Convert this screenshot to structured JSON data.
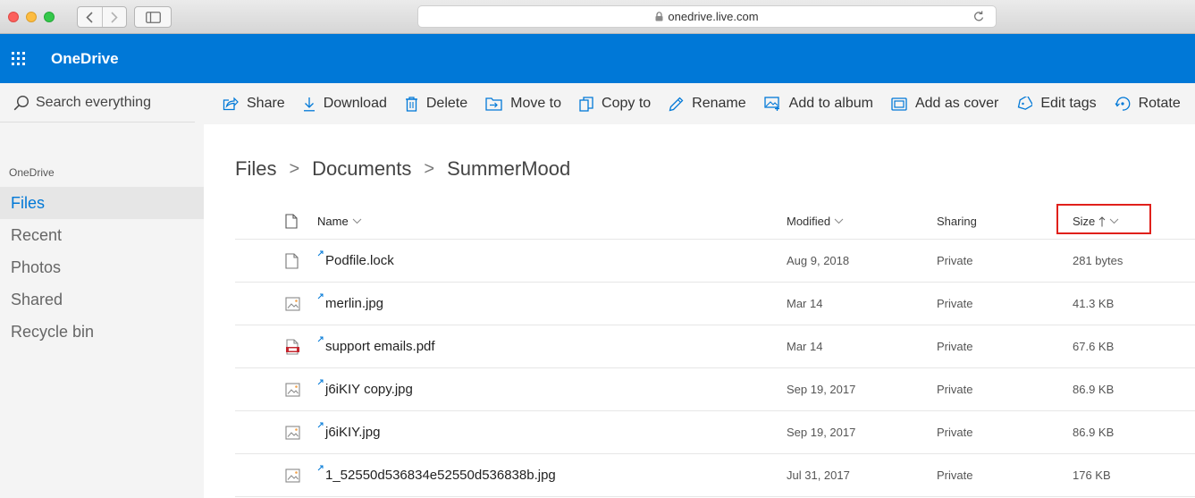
{
  "browser": {
    "url": "onedrive.live.com"
  },
  "app": {
    "brand": "OneDrive"
  },
  "left_nav": {
    "search_placeholder": "Search everything",
    "section_label": "OneDrive",
    "items": [
      {
        "label": "Files",
        "active": true
      },
      {
        "label": "Recent",
        "active": false
      },
      {
        "label": "Photos",
        "active": false
      },
      {
        "label": "Shared",
        "active": false
      },
      {
        "label": "Recycle bin",
        "active": false
      }
    ]
  },
  "command_bar": {
    "share": "Share",
    "download": "Download",
    "delete": "Delete",
    "move_to": "Move to",
    "copy_to": "Copy to",
    "rename": "Rename",
    "add_to_album": "Add to album",
    "add_as_cover": "Add as cover",
    "edit_tags": "Edit tags",
    "rotate": "Rotate"
  },
  "breadcrumb": [
    "Files",
    "Documents",
    "SummerMood"
  ],
  "table": {
    "headers": {
      "name": "Name",
      "modified": "Modified",
      "sharing": "Sharing",
      "size": "Size"
    },
    "sort": {
      "column": "size",
      "direction": "ascending",
      "highlighted": true
    },
    "rows": [
      {
        "type": "file",
        "name": "Podfile.lock",
        "modified": "Aug 9, 2018",
        "sharing": "Private",
        "size": "281 bytes"
      },
      {
        "type": "image",
        "name": "merlin.jpg",
        "modified": "Mar 14",
        "sharing": "Private",
        "size": "41.3 KB"
      },
      {
        "type": "pdf",
        "name": "support emails.pdf",
        "modified": "Mar 14",
        "sharing": "Private",
        "size": "67.6 KB"
      },
      {
        "type": "image",
        "name": "j6iKIY copy.jpg",
        "modified": "Sep 19, 2017",
        "sharing": "Private",
        "size": "86.9 KB"
      },
      {
        "type": "image",
        "name": "j6iKIY.jpg",
        "modified": "Sep 19, 2017",
        "sharing": "Private",
        "size": "86.9 KB"
      },
      {
        "type": "image",
        "name": "1_52550d536834e52550d536838b.jpg",
        "modified": "Jul 31, 2017",
        "sharing": "Private",
        "size": "176 KB"
      }
    ]
  },
  "colors": {
    "brand_blue": "#0078d7",
    "highlight_red": "#e0201b",
    "pdf_red": "#c4262e"
  }
}
